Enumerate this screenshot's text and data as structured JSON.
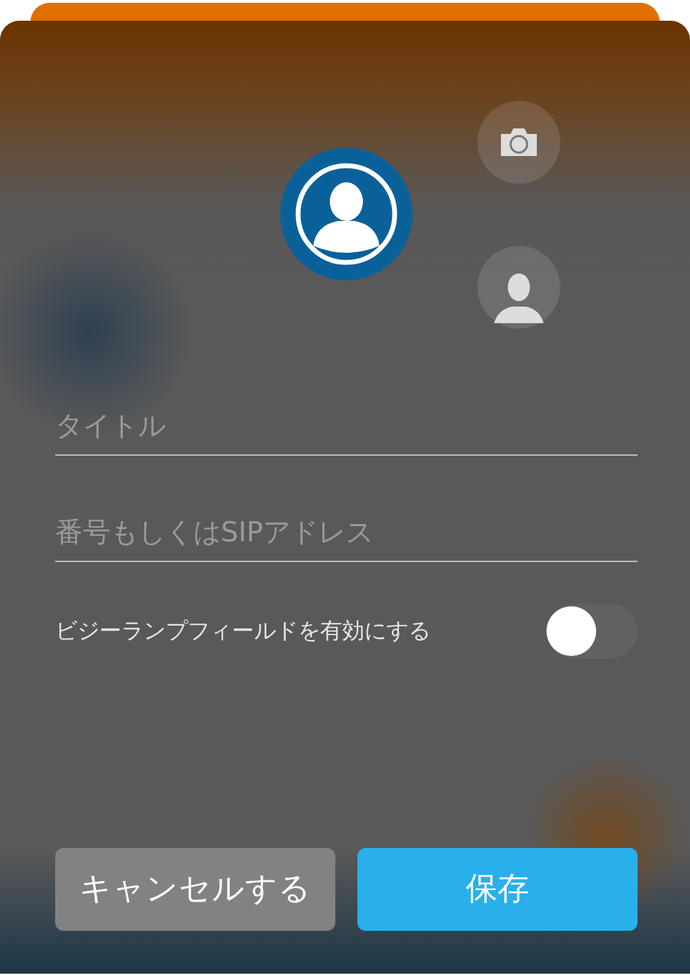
{
  "fields": [
    {
      "placeholder": "タイトル"
    },
    {
      "placeholder": "番号もしくはSIPアドレス"
    }
  ],
  "busy_lamp": {
    "label": "ビジーランプフィールドを有効にする",
    "on": false
  },
  "buttons": [
    {
      "label": "キャンセルする",
      "kind": "secondary"
    },
    {
      "label": "保存",
      "kind": "primary"
    }
  ]
}
